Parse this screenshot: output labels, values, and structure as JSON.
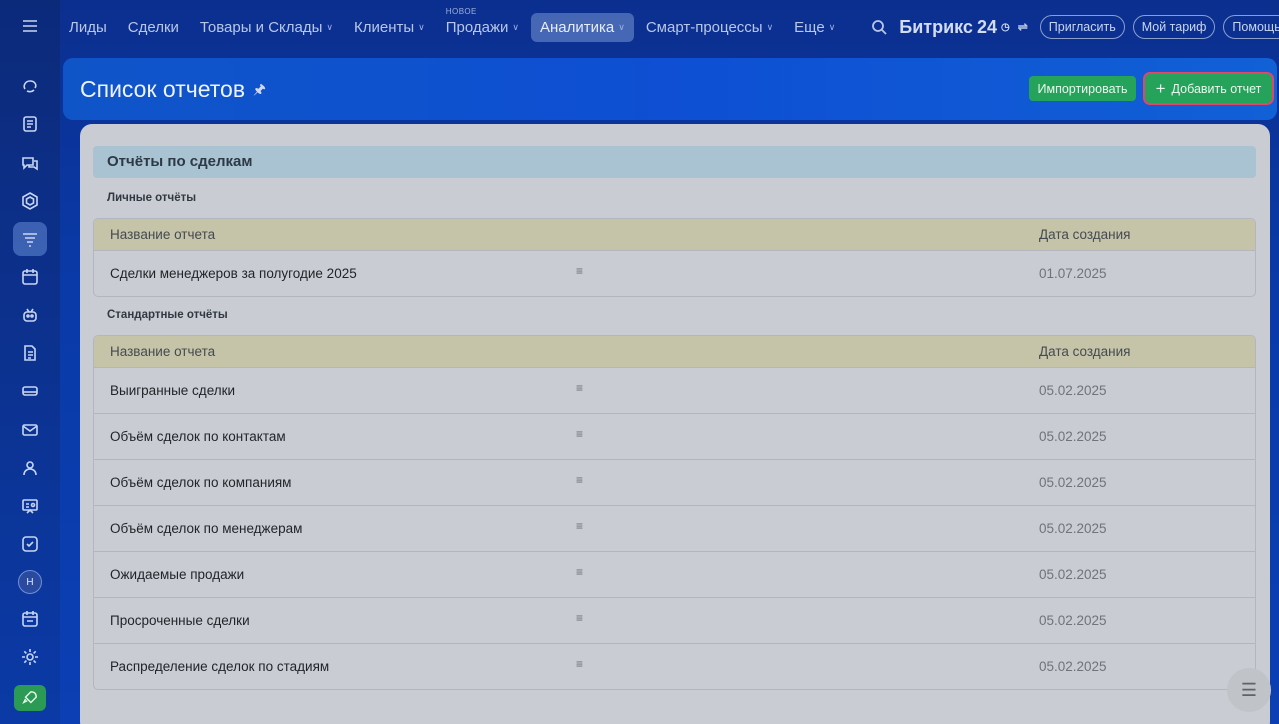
{
  "topnav": {
    "items": [
      {
        "label": "Лиды",
        "chevron": false,
        "badge": ""
      },
      {
        "label": "Сделки",
        "chevron": false,
        "badge": ""
      },
      {
        "label": "Товары и Склады",
        "chevron": true,
        "badge": ""
      },
      {
        "label": "Клиенты",
        "chevron": true,
        "badge": ""
      },
      {
        "label": "Продажи",
        "chevron": true,
        "badge": "НОВОЕ"
      },
      {
        "label": "Аналитика",
        "chevron": true,
        "badge": "",
        "active": true
      },
      {
        "label": "Смарт-процессы",
        "chevron": true,
        "badge": ""
      },
      {
        "label": "Еще",
        "chevron": true,
        "badge": ""
      }
    ],
    "brand_name": "Битрикс",
    "brand_number": "24",
    "invite_label": "Пригласить",
    "tariff_label": "Мой тариф",
    "help_label": "Помощь"
  },
  "rail": {
    "avatar_initial": "Н"
  },
  "header": {
    "title": "Список отчетов",
    "import_label": "Импортировать",
    "add_label": "Добавить отчет"
  },
  "content": {
    "section_title": "Отчёты по сделкам",
    "personal": {
      "subtitle": "Личные отчёты",
      "columns": [
        "Название отчета",
        "Дата создания"
      ],
      "rows": [
        {
          "name": "Сделки менеджеров за полугодие 2025",
          "date": "01.07.2025"
        }
      ]
    },
    "standard": {
      "subtitle": "Стандартные отчёты",
      "columns": [
        "Название отчета",
        "Дата создания"
      ],
      "rows": [
        {
          "name": "Выигранные сделки",
          "date": "05.02.2025"
        },
        {
          "name": "Объём сделок по контактам",
          "date": "05.02.2025"
        },
        {
          "name": "Объём сделок по компаниям",
          "date": "05.02.2025"
        },
        {
          "name": "Объём сделок по менеджерам",
          "date": "05.02.2025"
        },
        {
          "name": "Ожидаемые продажи",
          "date": "05.02.2025"
        },
        {
          "name": "Просроченные сделки",
          "date": "05.02.2025"
        },
        {
          "name": "Распределение сделок по стадиям",
          "date": "05.02.2025"
        }
      ]
    }
  },
  "colors": {
    "accent_green": "#26a35a",
    "highlight_red": "#e0486b",
    "header_blue": "#0f55c8"
  }
}
